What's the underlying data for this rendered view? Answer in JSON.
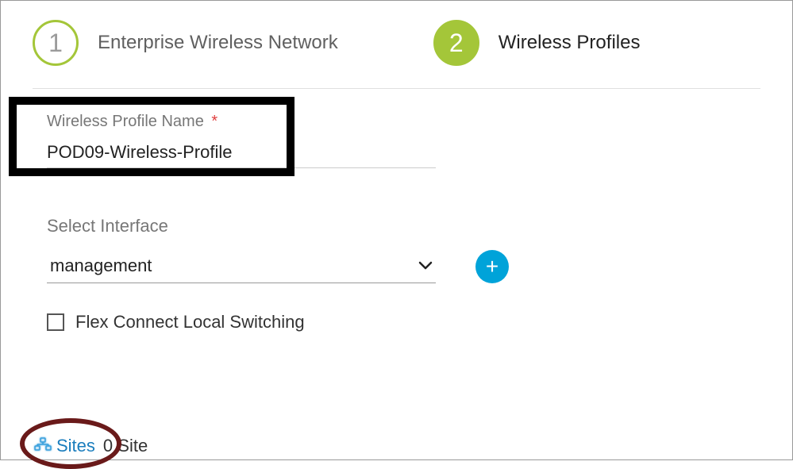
{
  "stepper": {
    "step1": {
      "number": "1",
      "label": "Enterprise Wireless Network"
    },
    "step2": {
      "number": "2",
      "label": "Wireless Profiles"
    }
  },
  "profile": {
    "name_label": "Wireless Profile Name",
    "required_mark": "*",
    "name_value": "POD09-Wireless-Profile"
  },
  "interface": {
    "label": "Select Interface",
    "selected": "management"
  },
  "flex": {
    "label": "Flex Connect Local Switching",
    "checked": false
  },
  "sites": {
    "link_label": "Sites",
    "count_text": "0 Site"
  }
}
